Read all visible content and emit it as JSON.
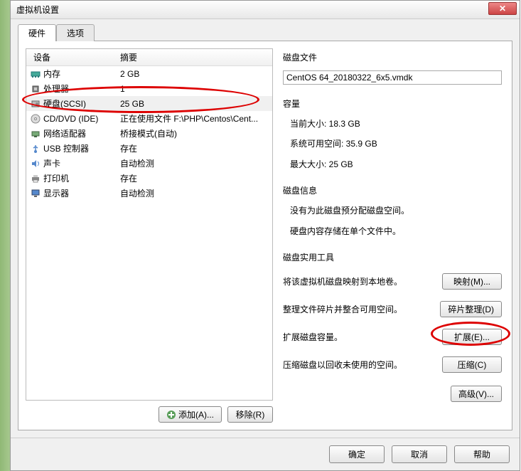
{
  "window": {
    "title": "虚拟机设置"
  },
  "tabs": {
    "hardware": "硬件",
    "options": "选项"
  },
  "list": {
    "header_device": "设备",
    "header_summary": "摘要",
    "rows": [
      {
        "name": "内存",
        "summary": "2 GB",
        "icon": "memory"
      },
      {
        "name": "处理器",
        "summary": "1",
        "icon": "cpu"
      },
      {
        "name": "硬盘(SCSI)",
        "summary": "25 GB",
        "icon": "disk",
        "selected": true
      },
      {
        "name": "CD/DVD (IDE)",
        "summary": "正在使用文件 F:\\PHP\\Centos\\Cent...",
        "icon": "cd"
      },
      {
        "name": "网络适配器",
        "summary": "桥接模式(自动)",
        "icon": "net"
      },
      {
        "name": "USB 控制器",
        "summary": "存在",
        "icon": "usb"
      },
      {
        "name": "声卡",
        "summary": "自动检测",
        "icon": "sound"
      },
      {
        "name": "打印机",
        "summary": "存在",
        "icon": "printer"
      },
      {
        "name": "显示器",
        "summary": "自动检测",
        "icon": "display"
      }
    ]
  },
  "left_buttons": {
    "add": "添加(A)...",
    "remove": "移除(R)"
  },
  "right": {
    "diskfile_title": "磁盘文件",
    "diskfile_value": "CentOS 64_20180322_6x5.vmdk",
    "capacity_title": "容量",
    "cap_current": "当前大小: 18.3 GB",
    "cap_free": "系统可用空间: 35.9 GB",
    "cap_max": "最大大小: 25 GB",
    "diskinfo_title": "磁盘信息",
    "diskinfo_line1": "没有为此磁盘预分配磁盘空间。",
    "diskinfo_line2": "硬盘内容存储在单个文件中。",
    "util_title": "磁盘实用工具",
    "util_map_desc": "将该虚拟机磁盘映射到本地卷。",
    "util_map_btn": "映射(M)...",
    "util_defrag_desc": "整理文件碎片并整合可用空间。",
    "util_defrag_btn": "碎片整理(D)",
    "util_expand_desc": "扩展磁盘容量。",
    "util_expand_btn": "扩展(E)...",
    "util_compact_desc": "压缩磁盘以回收未使用的空间。",
    "util_compact_btn": "压缩(C)",
    "adv_btn": "高级(V)..."
  },
  "bottom": {
    "ok": "确定",
    "cancel": "取消",
    "help": "帮助"
  }
}
